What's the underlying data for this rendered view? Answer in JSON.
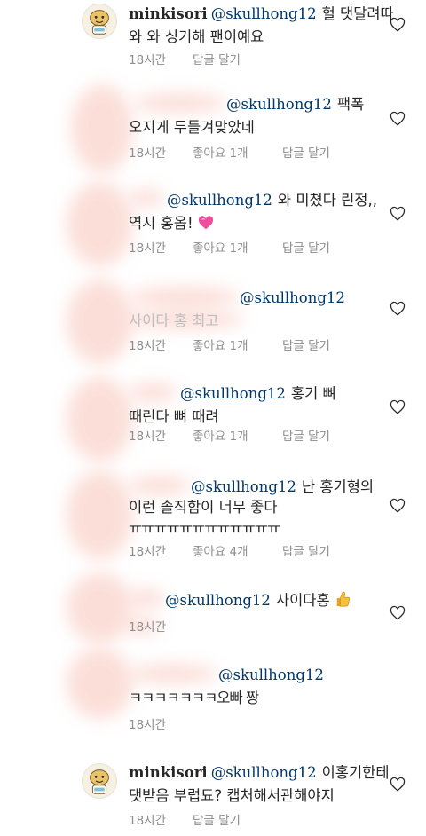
{
  "comments": [
    {
      "user": "minkisori",
      "mention": "@skullhong12",
      "line1": "헐 댓달려따",
      "line2": "와 와 싱기해  팬이예요",
      "time": "18시간",
      "likes": "",
      "reply": "답글 달기"
    },
    {
      "user": "",
      "mention": "@skullhong12",
      "line1": "팩폭",
      "line2": "오지게 두들겨맞았네",
      "time": "18시간",
      "likes": "좋아요 1개",
      "reply": "답글 달기"
    },
    {
      "user": "",
      "mention": "@skullhong12",
      "line1": "와 미쳤다 린정,,",
      "line2": "역시 홍옵!",
      "emoji": "pink-heart",
      "time": "18시간",
      "likes": "좋아요 1개",
      "reply": "답글 달기"
    },
    {
      "user": "",
      "mention": "@skullhong12",
      "line1": "",
      "line2": "사이다 홍 최고",
      "time": "18시간",
      "likes": "좋아요 1개",
      "reply": "답글 달기"
    },
    {
      "user": "",
      "mention": "@skullhong12",
      "line1": "홍기 뼈",
      "line2": "때린다 뼈 때려",
      "time": "18시간",
      "likes": "좋아요 1개",
      "reply": "답글 달기"
    },
    {
      "user": "",
      "mention": "@skullhong12",
      "line1": "난 홍기형의",
      "line2": "이런 솔직함이 너무 좋다",
      "line3": "ㅠㅠㅠㅠㅠㅠㅠㅠㅠㅠㅠㅠ",
      "time": "18시간",
      "likes": "좋아요 4개",
      "reply": "답글 달기"
    },
    {
      "user": "",
      "mention": "@skullhong12",
      "line1": "사이다홍",
      "emoji": "thumbs-up",
      "time": "18시간",
      "likes": "",
      "reply": ""
    },
    {
      "user": "",
      "mention": "@skullhong12",
      "line1": "",
      "line2": "ㅋㅋㅋㅋㅋㅋㅋ오빠 짱",
      "time": "18시간",
      "likes": "",
      "reply": ""
    },
    {
      "user": "minkisori",
      "mention": "@skullhong12",
      "line1": "이홍기한테",
      "line2": "댓받음 부럽됴? 캡처해서관해야지",
      "time": "18시간",
      "likes": "",
      "reply": "답글 달기"
    }
  ],
  "colors": {
    "text": "#262626",
    "mention": "#00376b",
    "meta": "#8e8e8e",
    "redaction": "#fbd9d2"
  }
}
